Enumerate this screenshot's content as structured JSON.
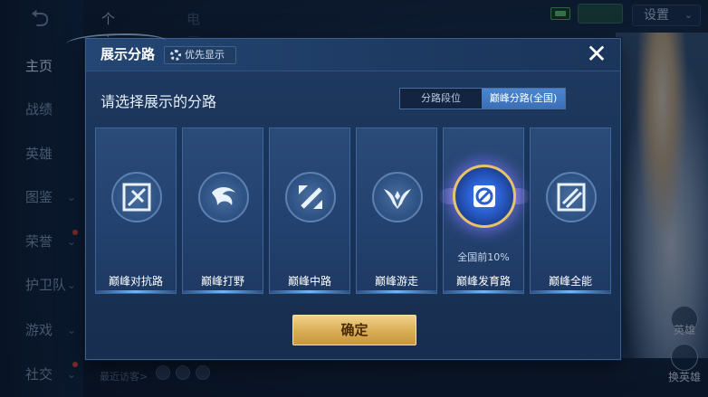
{
  "background": {
    "back_icon": "back-arrow-icon",
    "sidebar": {
      "items": [
        {
          "label": "主页",
          "active": true,
          "chevron": false,
          "dot": false
        },
        {
          "label": "战绩",
          "active": false,
          "chevron": false,
          "dot": false
        },
        {
          "label": "英雄",
          "active": false,
          "chevron": false,
          "dot": false
        },
        {
          "label": "图鉴",
          "active": false,
          "chevron": true,
          "dot": false
        },
        {
          "label": "荣誉",
          "active": false,
          "chevron": true,
          "dot": true
        },
        {
          "label": "护卫队",
          "active": false,
          "chevron": true,
          "dot": false
        },
        {
          "label": "游戏",
          "active": false,
          "chevron": true,
          "dot": false
        },
        {
          "label": "社交",
          "active": false,
          "chevron": true,
          "dot": true
        }
      ]
    },
    "top_tabs": [
      {
        "label": "个人主页"
      },
      {
        "label": "电竞"
      }
    ],
    "settings_label": "设置",
    "recent_visitors_label": "最近访客>",
    "hero_labels": [
      "英雄",
      "换英雄"
    ]
  },
  "modal": {
    "title": "展示分路",
    "priority_chip_label": "优先显示",
    "close_symbol": "✕",
    "subtitle": "请选择展示的分路",
    "toggle": {
      "options": [
        "分路段位",
        "巅峰分路(全国)"
      ],
      "selected_index": 1
    },
    "lanes": [
      {
        "name": "巅峰对抗路",
        "rank": "",
        "emblem": "clash-lane-icon",
        "featured": false
      },
      {
        "name": "巅峰打野",
        "rank": "",
        "emblem": "jungle-icon",
        "featured": false
      },
      {
        "name": "巅峰中路",
        "rank": "",
        "emblem": "mid-lane-icon",
        "featured": false
      },
      {
        "name": "巅峰游走",
        "rank": "",
        "emblem": "roam-icon",
        "featured": false
      },
      {
        "name": "巅峰发育路",
        "rank": "全国前10%",
        "emblem": "farm-lane-icon",
        "featured": true
      },
      {
        "name": "巅峰全能",
        "rank": "",
        "emblem": "all-round-icon",
        "featured": false
      }
    ],
    "confirm_label": "确定"
  },
  "colors": {
    "accent_blue": "#3a70b8",
    "confirm_gold": "#d9ad55",
    "featured_ring": "#e7c36b"
  }
}
